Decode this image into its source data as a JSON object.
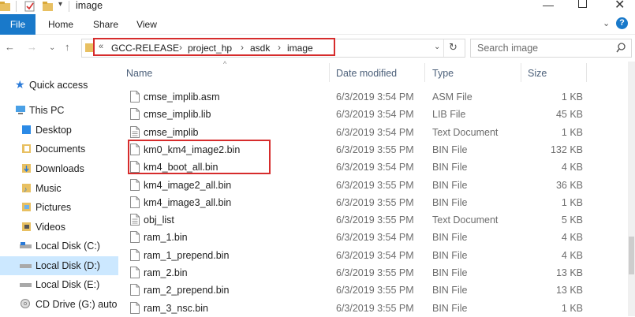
{
  "window": {
    "title": "image"
  },
  "ribbon": {
    "tabs": [
      "File",
      "Home",
      "Share",
      "View"
    ]
  },
  "address": {
    "crumbs": [
      "GCC-RELEASE",
      "project_hp",
      "asdk",
      "image"
    ],
    "prefix": "«"
  },
  "search": {
    "placeholder": "Search image"
  },
  "sidebar": {
    "items": [
      {
        "label": "Quick access",
        "icon": "star-icon"
      },
      {
        "label": "This PC",
        "icon": "computer-icon"
      },
      {
        "label": "Desktop",
        "icon": "desktop-folder-icon"
      },
      {
        "label": "Documents",
        "icon": "documents-folder-icon"
      },
      {
        "label": "Downloads",
        "icon": "downloads-folder-icon"
      },
      {
        "label": "Music",
        "icon": "music-folder-icon"
      },
      {
        "label": "Pictures",
        "icon": "pictures-folder-icon"
      },
      {
        "label": "Videos",
        "icon": "videos-folder-icon"
      },
      {
        "label": "Local Disk (C:)",
        "icon": "drive-icon"
      },
      {
        "label": "Local Disk (D:)",
        "icon": "drive-icon",
        "selected": true
      },
      {
        "label": "Local Disk (E:)",
        "icon": "drive-icon"
      },
      {
        "label": "CD Drive (G:) auto",
        "icon": "cd-drive-icon"
      }
    ]
  },
  "columns": {
    "name": "Name",
    "date": "Date modified",
    "type": "Type",
    "size": "Size"
  },
  "files": [
    {
      "name": "cmse_implib.asm",
      "date": "6/3/2019 3:54 PM",
      "type": "ASM File",
      "size": "1 KB"
    },
    {
      "name": "cmse_implib.lib",
      "date": "6/3/2019 3:54 PM",
      "type": "LIB File",
      "size": "45 KB"
    },
    {
      "name": "cmse_implib",
      "date": "6/3/2019 3:54 PM",
      "type": "Text Document",
      "size": "1 KB"
    },
    {
      "name": "km0_km4_image2.bin",
      "date": "6/3/2019 3:55 PM",
      "type": "BIN File",
      "size": "132 KB"
    },
    {
      "name": "km4_boot_all.bin",
      "date": "6/3/2019 3:54 PM",
      "type": "BIN File",
      "size": "4 KB"
    },
    {
      "name": "km4_image2_all.bin",
      "date": "6/3/2019 3:55 PM",
      "type": "BIN File",
      "size": "36 KB"
    },
    {
      "name": "km4_image3_all.bin",
      "date": "6/3/2019 3:55 PM",
      "type": "BIN File",
      "size": "1 KB"
    },
    {
      "name": "obj_list",
      "date": "6/3/2019 3:55 PM",
      "type": "Text Document",
      "size": "5 KB"
    },
    {
      "name": "ram_1.bin",
      "date": "6/3/2019 3:54 PM",
      "type": "BIN File",
      "size": "4 KB"
    },
    {
      "name": "ram_1_prepend.bin",
      "date": "6/3/2019 3:54 PM",
      "type": "BIN File",
      "size": "4 KB"
    },
    {
      "name": "ram_2.bin",
      "date": "6/3/2019 3:55 PM",
      "type": "BIN File",
      "size": "13 KB"
    },
    {
      "name": "ram_2_prepend.bin",
      "date": "6/3/2019 3:55 PM",
      "type": "BIN File",
      "size": "13 KB"
    },
    {
      "name": "ram_3_nsc.bin",
      "date": "6/3/2019 3:55 PM",
      "type": "BIN File",
      "size": "1 KB"
    }
  ],
  "colors": {
    "accent": "#1979ca",
    "highlight": "#d62c2c",
    "selected": "#cce8ff"
  }
}
